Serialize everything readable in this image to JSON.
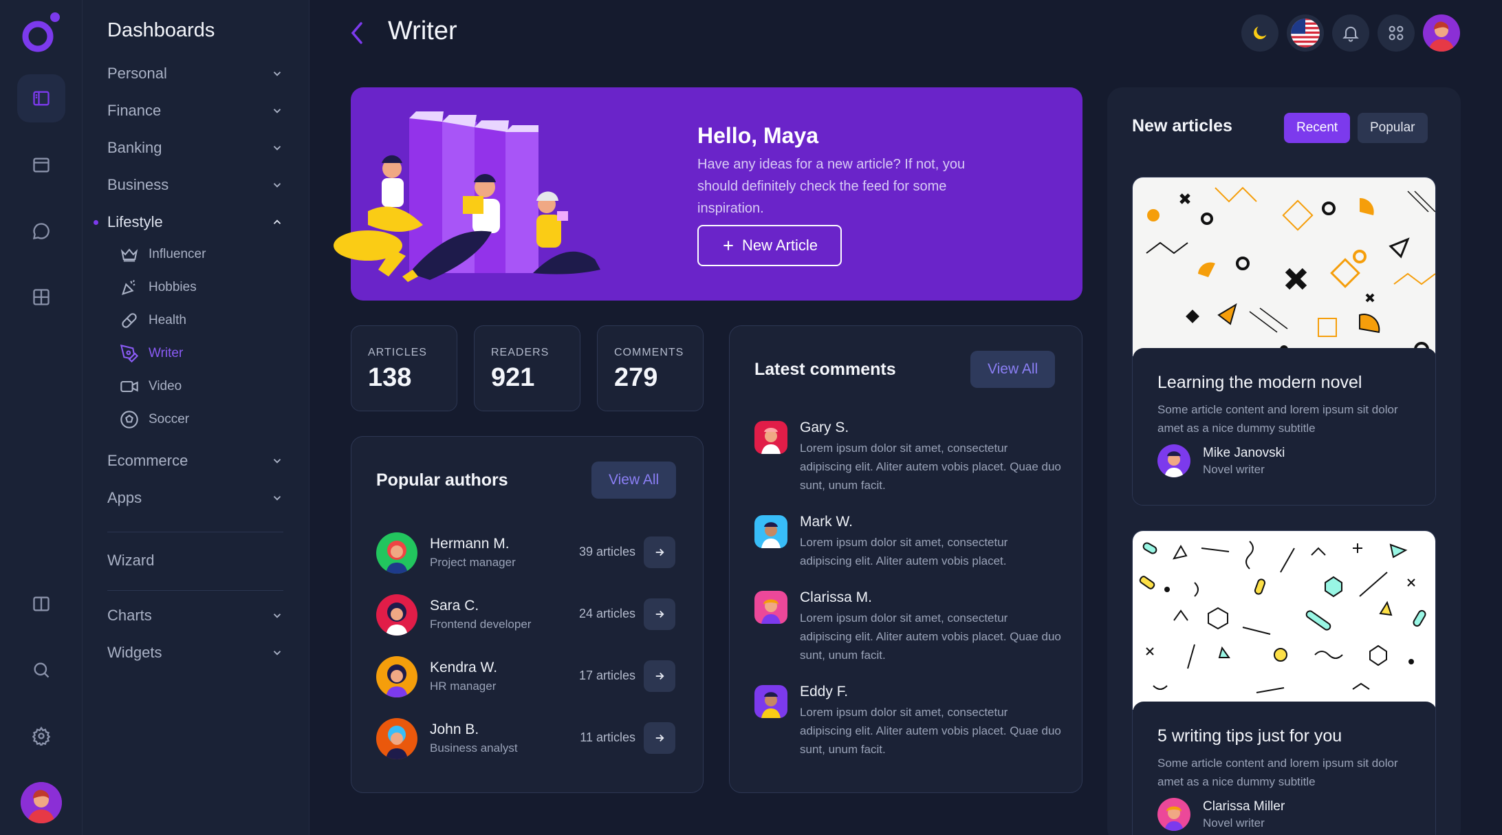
{
  "sidebar": {
    "title": "Dashboards",
    "sections": [
      "Personal",
      "Finance",
      "Banking",
      "Business",
      "Lifestyle"
    ],
    "lifestyle_items": [
      "Influencer",
      "Hobbies",
      "Health",
      "Writer",
      "Video",
      "Soccer"
    ],
    "more": [
      "Ecommerce",
      "Apps"
    ],
    "wizard": "Wizard",
    "bottom": [
      "Charts",
      "Widgets"
    ]
  },
  "header": {
    "title": "Writer"
  },
  "hero": {
    "title": "Hello, Maya",
    "text": "Have any ideas for a new article? If not, you should definitely check the feed for some inspiration.",
    "button": "New Article"
  },
  "stats": [
    {
      "label": "ARTICLES",
      "value": "138"
    },
    {
      "label": "READERS",
      "value": "921"
    },
    {
      "label": "COMMENTS",
      "value": "279"
    }
  ],
  "authors": {
    "title": "Popular authors",
    "view_all": "View All",
    "items": [
      {
        "name": "Hermann M.",
        "role": "Project manager",
        "count": "39 articles"
      },
      {
        "name": "Sara C.",
        "role": "Frontend developer",
        "count": "24 articles"
      },
      {
        "name": "Kendra W.",
        "role": "HR manager",
        "count": "17 articles"
      },
      {
        "name": "John B.",
        "role": "Business analyst",
        "count": "11 articles"
      }
    ]
  },
  "comments": {
    "title": "Latest comments",
    "view_all": "View All",
    "items": [
      {
        "name": "Gary S.",
        "text": "Lorem ipsum dolor sit amet, consectetur adipiscing elit. Aliter autem vobis placet. Quae duo sunt, unum facit."
      },
      {
        "name": "Mark W.",
        "text": "Lorem ipsum dolor sit amet, consectetur adipiscing elit. Aliter autem vobis placet."
      },
      {
        "name": "Clarissa M.",
        "text": "Lorem ipsum dolor sit amet, consectetur adipiscing elit. Aliter autem vobis placet. Quae duo sunt, unum facit."
      },
      {
        "name": "Eddy F.",
        "text": "Lorem ipsum dolor sit amet, consectetur adipiscing elit. Aliter autem vobis placet. Quae duo sunt, unum facit."
      }
    ]
  },
  "new_articles": {
    "title": "New articles",
    "tabs": [
      "Recent",
      "Popular"
    ],
    "items": [
      {
        "title": "Learning the modern novel",
        "desc": "Some article content and lorem ipsum sit dolor amet as a nice dummy subtitle",
        "author": "Mike Janovski",
        "role": "Novel writer"
      },
      {
        "title": "5 writing tips just for you",
        "desc": "Some article content and lorem ipsum sit dolor amet as a nice dummy subtitle",
        "author": "Clarissa Miller",
        "role": "Novel writer"
      }
    ]
  },
  "colors": {
    "accent": "#7c3aed",
    "hero": "#6a24c9",
    "background": "#151b2e",
    "panel": "#1b2236"
  }
}
